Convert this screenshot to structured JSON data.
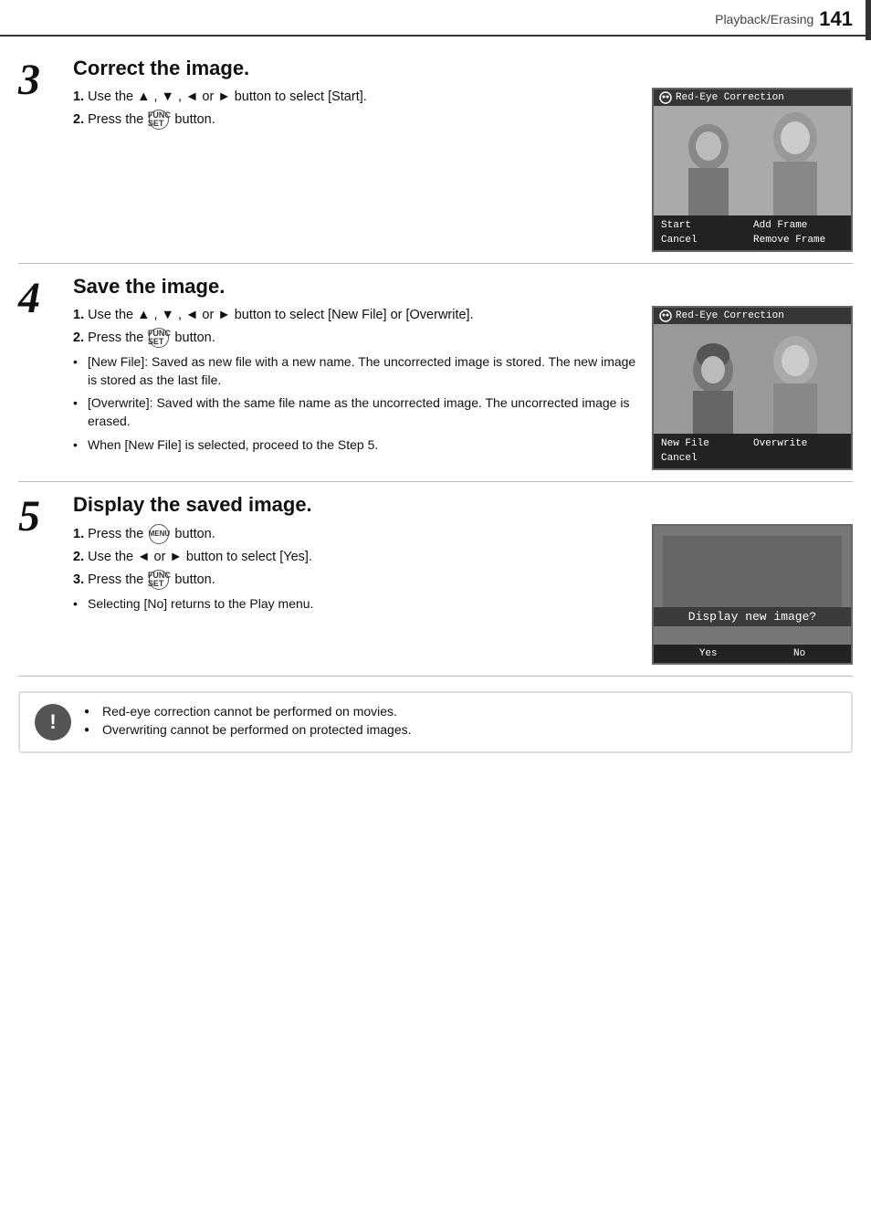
{
  "header": {
    "section": "Playback/Erasing",
    "page_number": "141"
  },
  "steps": [
    {
      "number": "3",
      "title": "Correct the image.",
      "instructions": [
        {
          "type": "numbered",
          "text": "1. Use the ▲ , ▼ , ◄ or ► button to select [Start]."
        },
        {
          "type": "numbered",
          "text": "2. Press the  button."
        }
      ],
      "bullets": [],
      "screen": {
        "title": "Red-Eye Correction",
        "menu": [
          "Start",
          "Add Frame",
          "Cancel",
          "Remove Frame"
        ]
      }
    },
    {
      "number": "4",
      "title": "Save the image.",
      "instructions": [
        {
          "type": "numbered",
          "text": "1. Use the ▲ , ▼ , ◄ or ► button to select [New File] or [Overwrite]."
        },
        {
          "type": "numbered",
          "text": "2. Press the  button."
        }
      ],
      "bullets": [
        "[New File]: Saved as new file with a new name. The uncorrected image is stored. The new image is stored as the last file.",
        "[Overwrite]: Saved with the same file name as the uncorrected image. The uncorrected image is erased.",
        "When [New File] is selected, proceed to the Step 5."
      ],
      "screen": {
        "title": "Red-Eye Correction",
        "menu": [
          "New File",
          "Overwrite",
          "Cancel",
          ""
        ]
      }
    },
    {
      "number": "5",
      "title": "Display the saved image.",
      "instructions": [
        {
          "type": "numbered",
          "text": "1. Press the  button."
        },
        {
          "type": "numbered",
          "text": "2. Use the ◄ or ► button to select [Yes]."
        },
        {
          "type": "numbered",
          "text": "3. Press the  button."
        }
      ],
      "bullets": [
        "Selecting [No] returns to the Play menu."
      ],
      "screen": {
        "title": "",
        "display_text": "Display new image?",
        "menu": [
          "Yes",
          "No"
        ]
      }
    }
  ],
  "notes": [
    "Red-eye correction cannot be performed on movies.",
    "Overwriting cannot be performed on protected images."
  ],
  "buttons": {
    "func_set": "FUNC SET",
    "menu": "MENU"
  }
}
